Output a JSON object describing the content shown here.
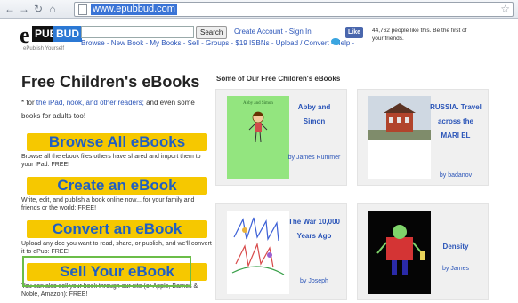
{
  "browser": {
    "url": "www.epubbud.com"
  },
  "brand": {
    "e": "e",
    "pub": "PUB",
    "bud": "BUD",
    "tagline": "ePublish Yourself"
  },
  "header": {
    "search_label": "Search",
    "account_links": "Create Account - Sign In",
    "nav_links": "Browse - New Book - My Books - Sell - Groups - $19 ISBNs - Upload / Convert - Help -",
    "fb_like": "Like",
    "fb_text": "44,762 people like this. Be the first of your friends."
  },
  "intro": {
    "title": "Free Children's eBooks",
    "subtitle_start": "* for ",
    "subtitle_link": "the iPad, nook, and other readers;",
    "subtitle_end": " and even some books for adults too!"
  },
  "ctas": [
    {
      "label": "Browse All eBooks",
      "desc": "Browse all the ebook files others have shared and import them to your iPad: FREE!"
    },
    {
      "label": "Create an eBook",
      "desc": "Write, edit, and publish a book online now... for your family and friends or the world: FREE!"
    },
    {
      "label": "Convert an eBook",
      "desc": "Upload any doc you want to read, share, or publish, and we'll convert it to ePub: FREE!"
    },
    {
      "label": "Sell Your eBook",
      "desc": "You can also sell your book through our site (or Apple, Barnes & Noble, Amazon): FREE!"
    }
  ],
  "featured": {
    "title": "Some of Our Free Children's eBooks",
    "books": [
      {
        "title": "Abby and Simon",
        "author": "by James Rummer",
        "cover_text": "Abby and Simon"
      },
      {
        "title": "RUSSIA. Travel across the MARI EL",
        "author": "by badanov"
      },
      {
        "title": "The War 10,000 Years Ago",
        "author": "by Joseph"
      },
      {
        "title": "Density",
        "author": "by James"
      }
    ]
  }
}
